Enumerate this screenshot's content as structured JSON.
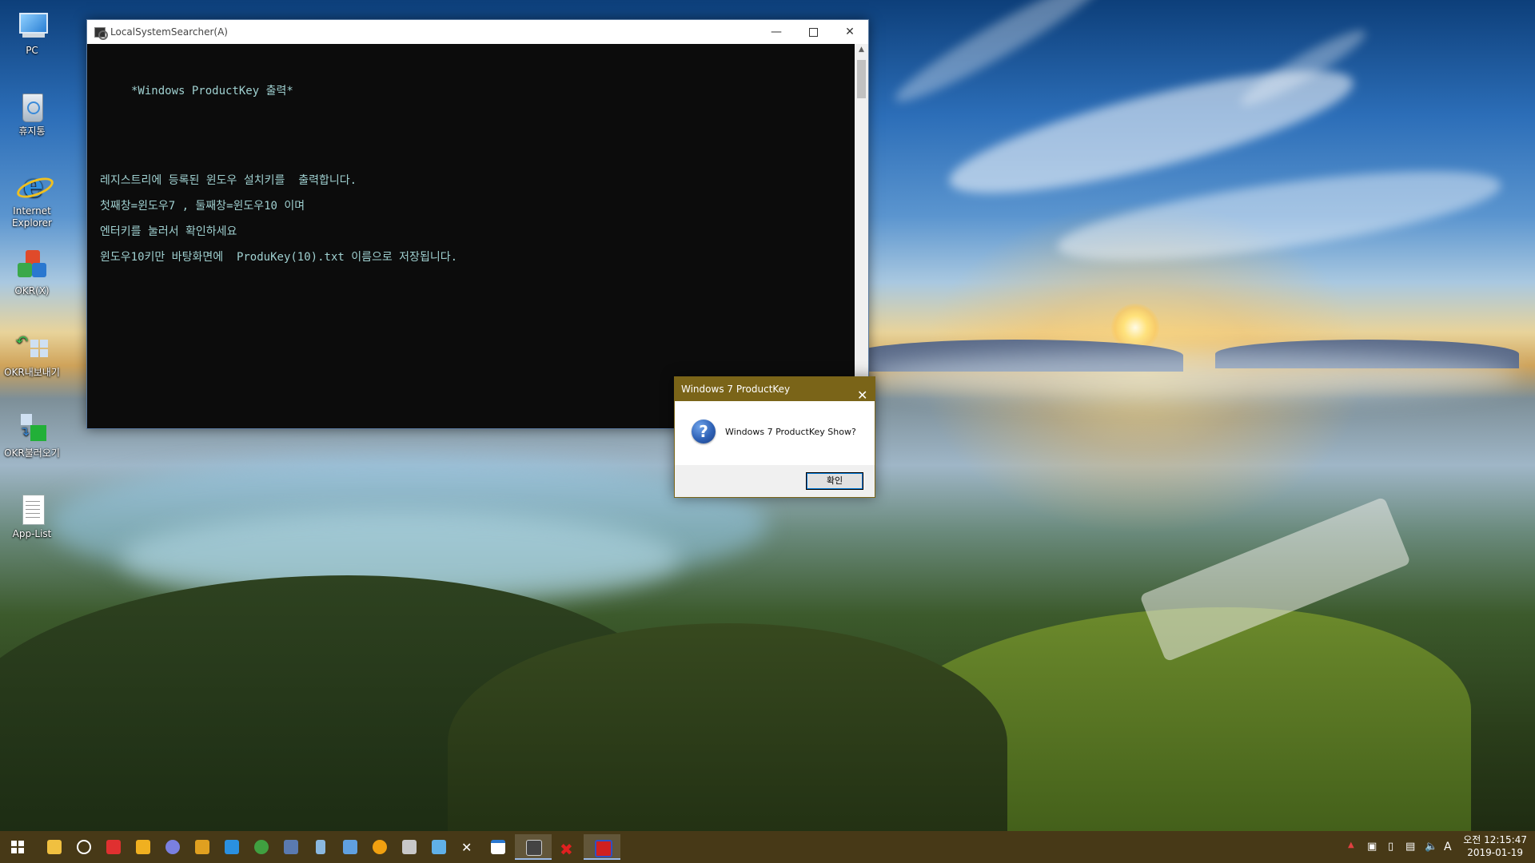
{
  "desktop": {
    "icons": [
      {
        "label": "PC"
      },
      {
        "label": "휴지통"
      },
      {
        "label": "Internet Explorer"
      },
      {
        "label": "OKR(X)"
      },
      {
        "label": "OKR내보내기"
      },
      {
        "label": "OKR불러오기"
      },
      {
        "label": "App-List"
      }
    ]
  },
  "console": {
    "title": "LocalSystemSearcher(A)",
    "lines": [
      "*Windows ProductKey 출력*",
      "레지스트리에 등록된 윈도우 설치키를  출력합니다.",
      "첫째창=윈도우7 , 둘째창=윈도우10 이며",
      "엔터키를 눌러서 확인하세요",
      "윈도우10키만 바탕화면에  ProduKey(10).txt 이름으로 저장됩니다."
    ]
  },
  "msgbox": {
    "title": "Windows 7 ProductKey",
    "message": "Windows 7 ProductKey Show?",
    "ok_label": "확인",
    "question_glyph": "?"
  },
  "taskbar": {
    "start_icon": "windows-logo-icon",
    "ime_label": "A",
    "clock_line1": "오전 12:15:47",
    "clock_line2": "2019-01-19"
  },
  "colors": {
    "console_text": "#9fd0d0",
    "msgbox_title_bg": "#7a6418",
    "taskbar_bg": "#46340c"
  }
}
